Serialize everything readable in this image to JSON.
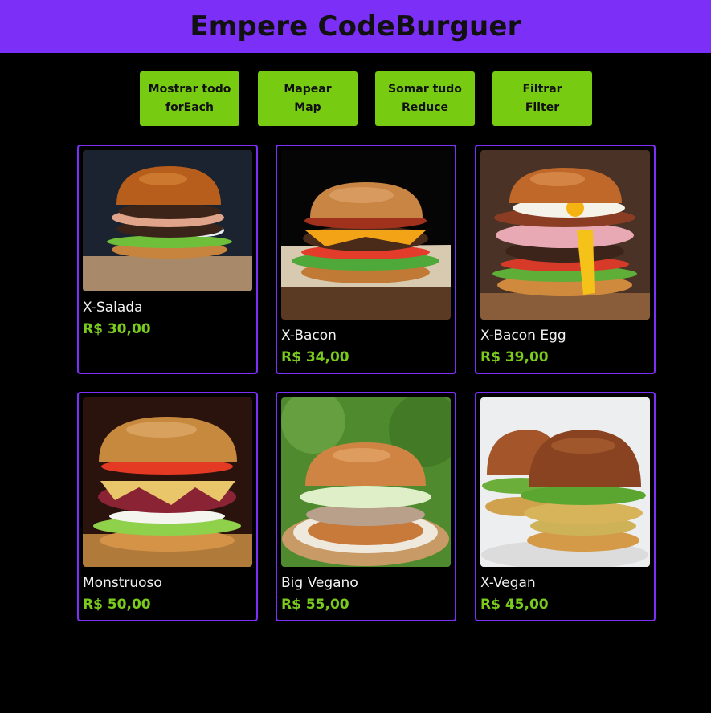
{
  "header": {
    "title": "Empere CodeBurguer"
  },
  "buttons": [
    {
      "line1": "Mostrar todo",
      "line2": "forEach"
    },
    {
      "line1": "Mapear",
      "line2": "Map"
    },
    {
      "line1": "Somar tudo",
      "line2": "Reduce"
    },
    {
      "line1": "Filtrar",
      "line2": "Filter"
    }
  ],
  "products": [
    {
      "name": "X-Salada",
      "price": "R$ 30,00"
    },
    {
      "name": "X-Bacon",
      "price": "R$ 34,00"
    },
    {
      "name": "X-Bacon Egg",
      "price": "R$ 39,00"
    },
    {
      "name": "Monstruoso",
      "price": "R$ 50,00"
    },
    {
      "name": "Big Vegano",
      "price": "R$ 55,00"
    },
    {
      "name": "X-Vegan",
      "price": "R$ 45,00"
    }
  ],
  "colors": {
    "accent_purple": "#7b2ff7",
    "button_green": "#77cc11",
    "price_green": "#7acb1c",
    "background": "#000000"
  }
}
